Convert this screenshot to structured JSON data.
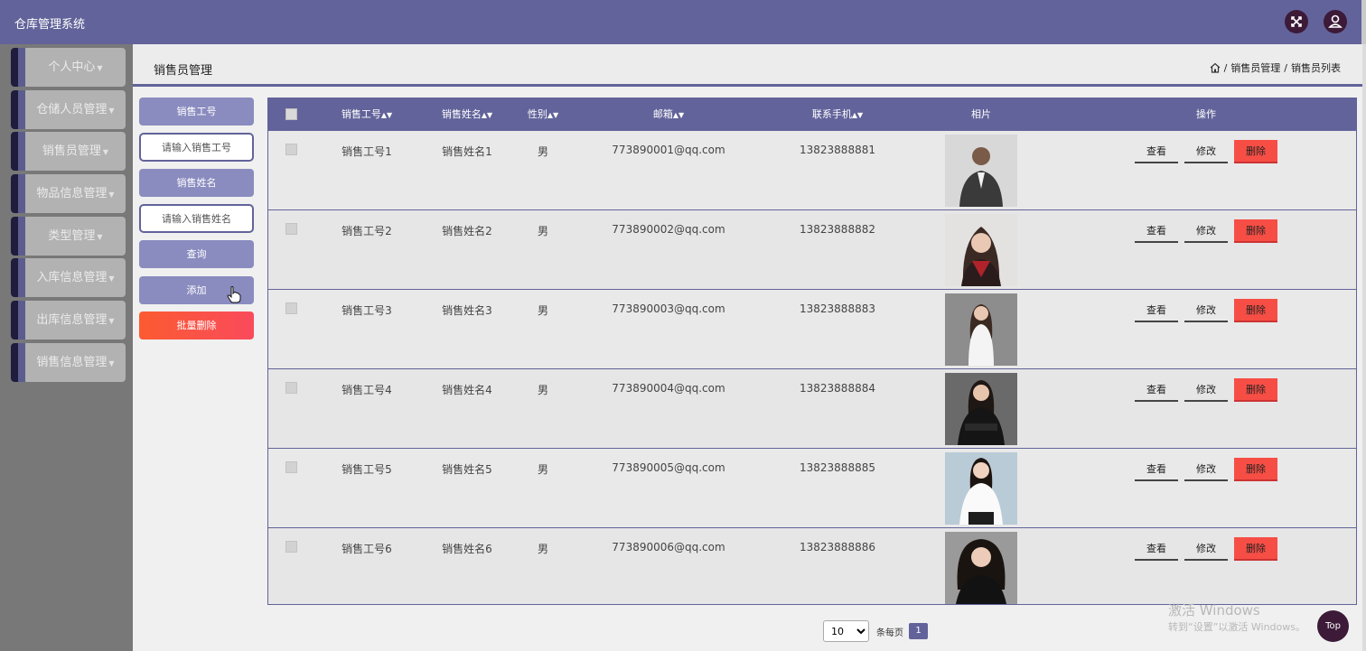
{
  "app_title": "仓库管理系统",
  "header_icons": [
    "fullscreen-icon",
    "user-icon"
  ],
  "sidebar": {
    "items": [
      {
        "label": "个人中心"
      },
      {
        "label": "仓储人员管理"
      },
      {
        "label": "销售员管理"
      },
      {
        "label": "物品信息管理"
      },
      {
        "label": "类型管理"
      },
      {
        "label": "入库信息管理"
      },
      {
        "label": "出库信息管理"
      },
      {
        "label": "销售信息管理"
      }
    ]
  },
  "page": {
    "title": "销售员管理",
    "breadcrumb": [
      "销售员管理",
      "销售员列表"
    ]
  },
  "search": {
    "field1_label": "销售工号",
    "field1_placeholder": "请输入销售工号",
    "field2_label": "销售姓名",
    "field2_placeholder": "请输入销售姓名",
    "query_label": "查询",
    "add_label": "添加",
    "batch_delete_label": "批量删除"
  },
  "table": {
    "columns": [
      "销售工号",
      "销售姓名",
      "性别",
      "邮箱",
      "联系手机",
      "相片",
      "操作"
    ],
    "rows": [
      {
        "id": "销售工号1",
        "name": "销售姓名1",
        "gender": "男",
        "email": "773890001@qq.com",
        "phone": "13823888881"
      },
      {
        "id": "销售工号2",
        "name": "销售姓名2",
        "gender": "男",
        "email": "773890002@qq.com",
        "phone": "13823888882"
      },
      {
        "id": "销售工号3",
        "name": "销售姓名3",
        "gender": "男",
        "email": "773890003@qq.com",
        "phone": "13823888883"
      },
      {
        "id": "销售工号4",
        "name": "销售姓名4",
        "gender": "男",
        "email": "773890004@qq.com",
        "phone": "13823888884"
      },
      {
        "id": "销售工号5",
        "name": "销售姓名5",
        "gender": "男",
        "email": "773890005@qq.com",
        "phone": "13823888885"
      },
      {
        "id": "销售工号6",
        "name": "销售姓名6",
        "gender": "男",
        "email": "773890006@qq.com",
        "phone": "13823888886"
      }
    ],
    "actions": {
      "view": "查看",
      "edit": "修改",
      "delete": "删除"
    }
  },
  "pagination": {
    "page_size": "10",
    "per_page_label": "条每页",
    "current_page": "1"
  },
  "watermark": {
    "line1": "激活 Windows",
    "line2": "转到“设置”以激活 Windows。"
  },
  "top_button": "Top",
  "colors": {
    "primary": "#62639a",
    "sidebar_bg": "#787878",
    "danger": "#f64e45"
  }
}
